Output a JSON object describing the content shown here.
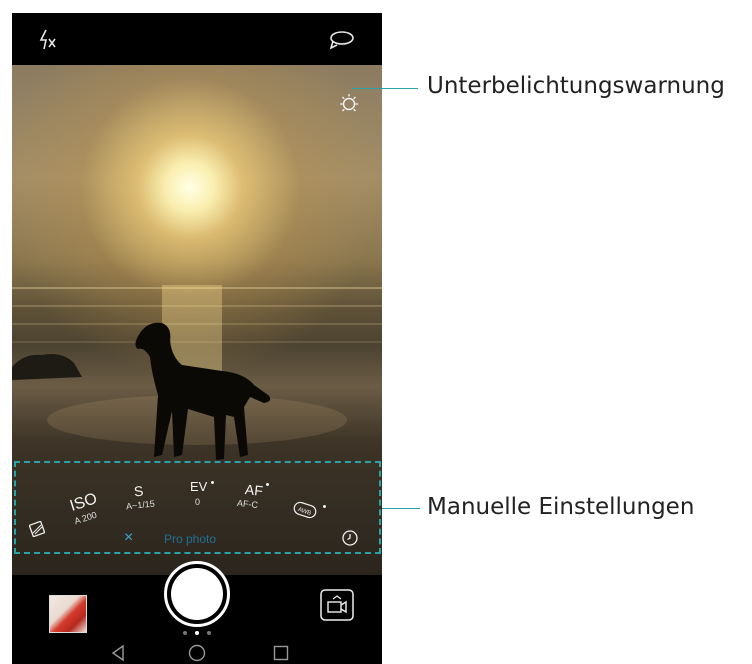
{
  "camera": {
    "top_bar": {
      "flash_icon": "flash-off-icon",
      "switch_icon": "switch-camera-icon"
    },
    "viewfinder": {
      "warning_icon": "underexposure-warning-icon"
    },
    "manual_settings": {
      "iso": {
        "label": "ISO",
        "value": "A 200"
      },
      "shutter": {
        "label": "S",
        "value": "A~1/15"
      },
      "ev": {
        "label": "EV",
        "value": "0"
      },
      "af": {
        "label": "AF",
        "value": "AF-C"
      },
      "awb": {
        "label": "AWB"
      },
      "mode_label": "Pro photo",
      "close_symbol": "×"
    }
  },
  "callouts": {
    "underexposure": "Unterbelichtungswarnung",
    "manual": "Manuelle Einstellungen"
  },
  "colors": {
    "accent": "#2aa3a8",
    "mode_label": "#1a8fc4"
  }
}
